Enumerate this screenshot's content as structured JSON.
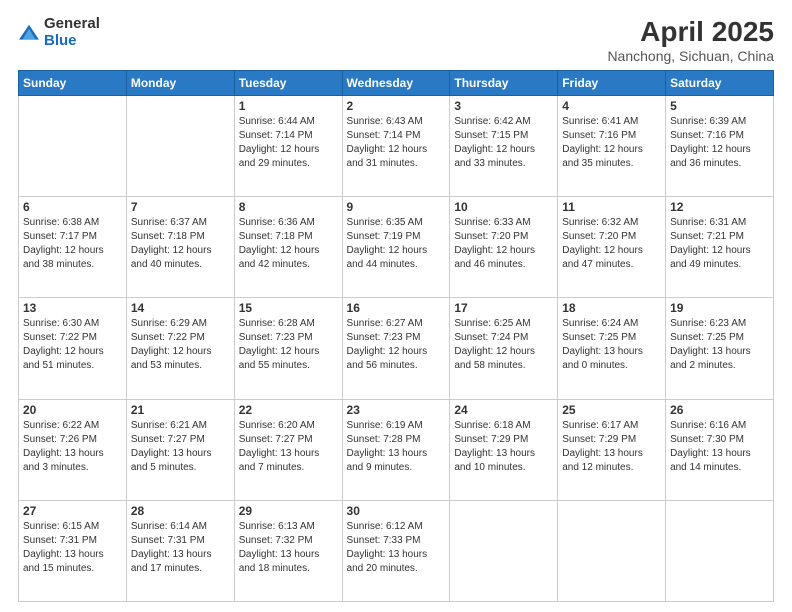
{
  "logo": {
    "general": "General",
    "blue": "Blue"
  },
  "title": "April 2025",
  "subtitle": "Nanchong, Sichuan, China",
  "headers": [
    "Sunday",
    "Monday",
    "Tuesday",
    "Wednesday",
    "Thursday",
    "Friday",
    "Saturday"
  ],
  "weeks": [
    [
      {
        "day": "",
        "detail": ""
      },
      {
        "day": "",
        "detail": ""
      },
      {
        "day": "1",
        "detail": "Sunrise: 6:44 AM\nSunset: 7:14 PM\nDaylight: 12 hours\nand 29 minutes."
      },
      {
        "day": "2",
        "detail": "Sunrise: 6:43 AM\nSunset: 7:14 PM\nDaylight: 12 hours\nand 31 minutes."
      },
      {
        "day": "3",
        "detail": "Sunrise: 6:42 AM\nSunset: 7:15 PM\nDaylight: 12 hours\nand 33 minutes."
      },
      {
        "day": "4",
        "detail": "Sunrise: 6:41 AM\nSunset: 7:16 PM\nDaylight: 12 hours\nand 35 minutes."
      },
      {
        "day": "5",
        "detail": "Sunrise: 6:39 AM\nSunset: 7:16 PM\nDaylight: 12 hours\nand 36 minutes."
      }
    ],
    [
      {
        "day": "6",
        "detail": "Sunrise: 6:38 AM\nSunset: 7:17 PM\nDaylight: 12 hours\nand 38 minutes."
      },
      {
        "day": "7",
        "detail": "Sunrise: 6:37 AM\nSunset: 7:18 PM\nDaylight: 12 hours\nand 40 minutes."
      },
      {
        "day": "8",
        "detail": "Sunrise: 6:36 AM\nSunset: 7:18 PM\nDaylight: 12 hours\nand 42 minutes."
      },
      {
        "day": "9",
        "detail": "Sunrise: 6:35 AM\nSunset: 7:19 PM\nDaylight: 12 hours\nand 44 minutes."
      },
      {
        "day": "10",
        "detail": "Sunrise: 6:33 AM\nSunset: 7:20 PM\nDaylight: 12 hours\nand 46 minutes."
      },
      {
        "day": "11",
        "detail": "Sunrise: 6:32 AM\nSunset: 7:20 PM\nDaylight: 12 hours\nand 47 minutes."
      },
      {
        "day": "12",
        "detail": "Sunrise: 6:31 AM\nSunset: 7:21 PM\nDaylight: 12 hours\nand 49 minutes."
      }
    ],
    [
      {
        "day": "13",
        "detail": "Sunrise: 6:30 AM\nSunset: 7:22 PM\nDaylight: 12 hours\nand 51 minutes."
      },
      {
        "day": "14",
        "detail": "Sunrise: 6:29 AM\nSunset: 7:22 PM\nDaylight: 12 hours\nand 53 minutes."
      },
      {
        "day": "15",
        "detail": "Sunrise: 6:28 AM\nSunset: 7:23 PM\nDaylight: 12 hours\nand 55 minutes."
      },
      {
        "day": "16",
        "detail": "Sunrise: 6:27 AM\nSunset: 7:23 PM\nDaylight: 12 hours\nand 56 minutes."
      },
      {
        "day": "17",
        "detail": "Sunrise: 6:25 AM\nSunset: 7:24 PM\nDaylight: 12 hours\nand 58 minutes."
      },
      {
        "day": "18",
        "detail": "Sunrise: 6:24 AM\nSunset: 7:25 PM\nDaylight: 13 hours\nand 0 minutes."
      },
      {
        "day": "19",
        "detail": "Sunrise: 6:23 AM\nSunset: 7:25 PM\nDaylight: 13 hours\nand 2 minutes."
      }
    ],
    [
      {
        "day": "20",
        "detail": "Sunrise: 6:22 AM\nSunset: 7:26 PM\nDaylight: 13 hours\nand 3 minutes."
      },
      {
        "day": "21",
        "detail": "Sunrise: 6:21 AM\nSunset: 7:27 PM\nDaylight: 13 hours\nand 5 minutes."
      },
      {
        "day": "22",
        "detail": "Sunrise: 6:20 AM\nSunset: 7:27 PM\nDaylight: 13 hours\nand 7 minutes."
      },
      {
        "day": "23",
        "detail": "Sunrise: 6:19 AM\nSunset: 7:28 PM\nDaylight: 13 hours\nand 9 minutes."
      },
      {
        "day": "24",
        "detail": "Sunrise: 6:18 AM\nSunset: 7:29 PM\nDaylight: 13 hours\nand 10 minutes."
      },
      {
        "day": "25",
        "detail": "Sunrise: 6:17 AM\nSunset: 7:29 PM\nDaylight: 13 hours\nand 12 minutes."
      },
      {
        "day": "26",
        "detail": "Sunrise: 6:16 AM\nSunset: 7:30 PM\nDaylight: 13 hours\nand 14 minutes."
      }
    ],
    [
      {
        "day": "27",
        "detail": "Sunrise: 6:15 AM\nSunset: 7:31 PM\nDaylight: 13 hours\nand 15 minutes."
      },
      {
        "day": "28",
        "detail": "Sunrise: 6:14 AM\nSunset: 7:31 PM\nDaylight: 13 hours\nand 17 minutes."
      },
      {
        "day": "29",
        "detail": "Sunrise: 6:13 AM\nSunset: 7:32 PM\nDaylight: 13 hours\nand 18 minutes."
      },
      {
        "day": "30",
        "detail": "Sunrise: 6:12 AM\nSunset: 7:33 PM\nDaylight: 13 hours\nand 20 minutes."
      },
      {
        "day": "",
        "detail": ""
      },
      {
        "day": "",
        "detail": ""
      },
      {
        "day": "",
        "detail": ""
      }
    ]
  ]
}
